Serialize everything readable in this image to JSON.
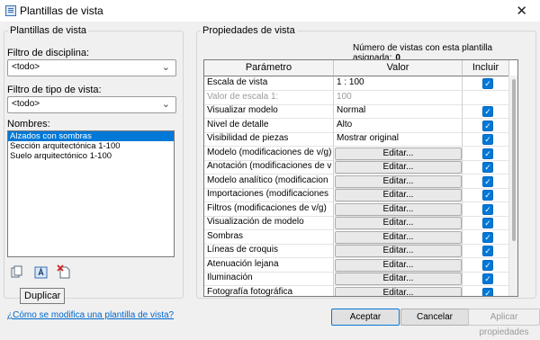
{
  "window": {
    "title": "Plantillas de vista"
  },
  "left": {
    "group_label": "Plantillas de vista",
    "discipline_label": "Filtro de disciplina:",
    "discipline_value": "<todo>",
    "viewtype_label": "Filtro de tipo de vista:",
    "viewtype_value": "<todo>",
    "names_label": "Nombres:",
    "names": [
      "Alzados con sombras",
      "Sección arquitectónica  1-100",
      "Suelo arquitectónico 1-100"
    ],
    "tooltip": "Duplicar",
    "help_link": "¿Cómo se modifica una plantilla de vista?"
  },
  "right": {
    "group_label": "Propiedades de vista",
    "count_label": "Número de vistas con esta plantilla asignada:",
    "count_value": "0",
    "columns": [
      "Parámetro",
      "Valor",
      "Incluir"
    ],
    "rows": [
      {
        "param": "Escala de vista",
        "value": "1 : 100",
        "kind": "text",
        "include": true
      },
      {
        "param": "Valor de escala    1:",
        "value": "100",
        "kind": "disabled",
        "include": null
      },
      {
        "param": "Visualizar modelo",
        "value": "Normal",
        "kind": "text",
        "include": true
      },
      {
        "param": "Nivel de detalle",
        "value": "Alto",
        "kind": "text",
        "include": true
      },
      {
        "param": "Visibilidad de piezas",
        "value": "Mostrar original",
        "kind": "text",
        "include": true
      },
      {
        "param": "Modelo (modificaciones de v/g)",
        "value": "Editar...",
        "kind": "button",
        "include": true
      },
      {
        "param": "Anotación (modificaciones de v/",
        "value": "Editar...",
        "kind": "button",
        "include": true
      },
      {
        "param": "Modelo analítico (modificacion",
        "value": "Editar...",
        "kind": "button",
        "include": true
      },
      {
        "param": "Importaciones (modificaciones",
        "value": "Editar...",
        "kind": "button",
        "include": true
      },
      {
        "param": "Filtros (modificaciones de v/g)",
        "value": "Editar...",
        "kind": "button",
        "include": true
      },
      {
        "param": "Visualización de modelo",
        "value": "Editar...",
        "kind": "button",
        "include": true
      },
      {
        "param": "Sombras",
        "value": "Editar...",
        "kind": "button",
        "include": true
      },
      {
        "param": "Líneas de croquis",
        "value": "Editar...",
        "kind": "button",
        "include": true
      },
      {
        "param": "Atenuación lejana",
        "value": "Editar...",
        "kind": "button",
        "include": true
      },
      {
        "param": "Iluminación",
        "value": "Editar...",
        "kind": "button",
        "include": true
      },
      {
        "param": "Fotografía fotográfica",
        "value": "Editar...",
        "kind": "button",
        "include": true
      }
    ]
  },
  "buttons": {
    "ok": "Aceptar",
    "cancel": "Cancelar",
    "apply": "Aplicar propiedades"
  },
  "colors": {
    "accent": "#0078d7",
    "link": "#0066cc"
  }
}
